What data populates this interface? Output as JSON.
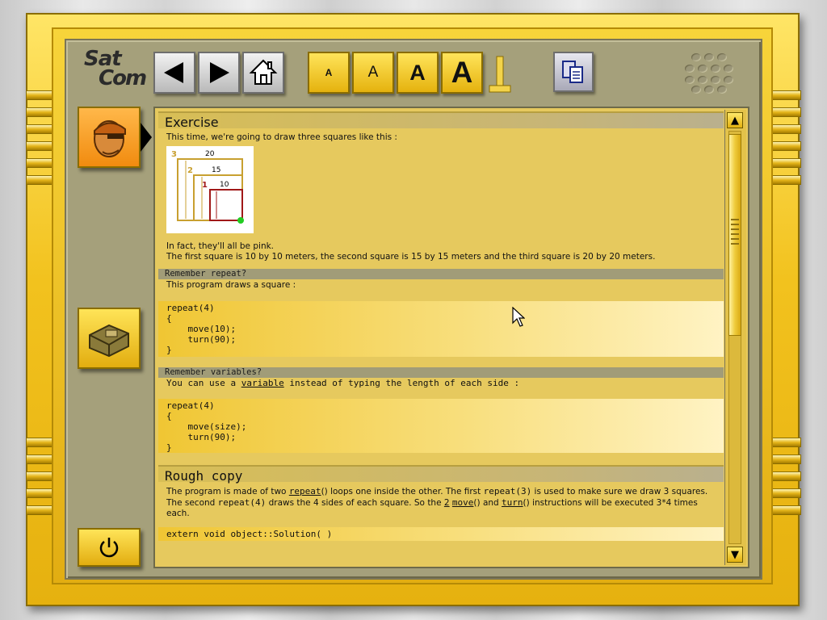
{
  "app": {
    "logo_line1": "Sat",
    "logo_line2": "Com"
  },
  "toolbar": {
    "back_icon": "back-arrow-icon",
    "forward_icon": "forward-arrow-icon",
    "home_icon": "home-icon",
    "font_sizes": [
      "A",
      "A",
      "A",
      "A"
    ],
    "copy_icon": "copy-clipboard-icon"
  },
  "sidebar": {
    "avatar_icon": "robot-head-icon",
    "book_icon": "book-icon",
    "power_icon": "power-icon"
  },
  "colors": {
    "accent_yellow": "#e6b10f",
    "panel_olive": "#a5a07b",
    "square1": "#a01818",
    "square2": "#c8a030",
    "square3": "#b89a30",
    "start_dot": "#22cc22"
  },
  "doc": {
    "exercise_title": "Exercise",
    "intro": "This time, we're going to draw three squares like this :",
    "figure": {
      "labels": {
        "n3": "3",
        "n2": "2",
        "n1": "1",
        "d20": "20",
        "d15": "15",
        "d10": "10"
      }
    },
    "pink_line": "In fact, they'll all be pink.",
    "sizes_line": "The first square is 10 by 10 meters, the second square is 15 by 15 meters and the third square is 20 by 20 meters.",
    "remember_repeat_title": "Remember repeat?",
    "repeat_desc": "This program draws a square :",
    "code1": "repeat(4)\n{\n    move(10);\n    turn(90);\n}",
    "remember_vars_title": "Remember variables?",
    "vars_pre": "You can use a ",
    "vars_link": "variable",
    "vars_post": " instead of typing the length of each side :",
    "code2": "repeat(4)\n{\n    move(size);\n    turn(90);\n}",
    "rough_title": "Rough copy",
    "rough_p1": "The program is made of two ",
    "rough_link_repeat": "repeat",
    "rough_p2": "() loops one inside the other. The first ",
    "rough_code_a": "repeat(3)",
    "rough_p3": " is used to make sure we draw 3 squares. The second ",
    "rough_code_b": "repeat(4)",
    "rough_p4": " draws the 4 sides of each square. So the ",
    "rough_num": "2",
    "rough_link_move": "move",
    "rough_p5": "() and ",
    "rough_link_turn": "turn",
    "rough_p6": "() instructions will be executed 3*4 times each.",
    "code3": "extern void object::Solution( )"
  }
}
